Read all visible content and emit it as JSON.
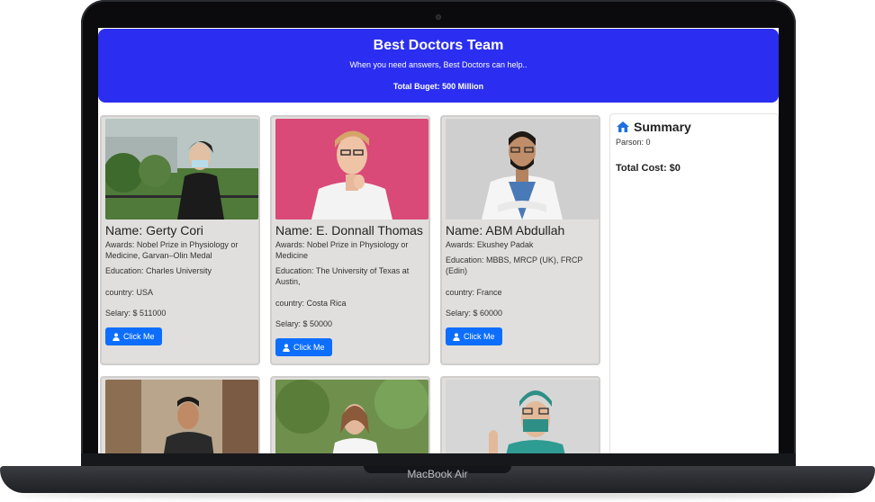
{
  "header": {
    "title": "Best Doctors Team",
    "subtitle": "When you need answers, Best Doctors can help..",
    "budget": "Total Buget: 500 Million"
  },
  "cards": [
    {
      "name": "Name: Gerty Cori",
      "awards": "Awards: Nobel Prize in Physiology or Medicine, Garvan–Olin Medal",
      "education": "Education: Charles University",
      "country": "country: USA",
      "salary": "Selary: $ 511000",
      "button": "Click Me"
    },
    {
      "name": "Name: E. Donnall Thomas",
      "awards": "Awards: Nobel Prize in Physiology or Medicine",
      "education": "Education: The University of Texas at Austin,",
      "country": "country: Costa Rica",
      "salary": "Selary: $ 50000",
      "button": "Click Me"
    },
    {
      "name": "Name: ABM Abdullah",
      "awards": "Awards: Ekushey Padak",
      "education": "Education: MBBS, MRCP (UK), FRCP (Edin)",
      "country": "country: France",
      "salary": "Selary: $ 60000",
      "button": "Click Me"
    }
  ],
  "summary": {
    "title": "Summary",
    "persons": "Parson: 0",
    "total_cost": "Total Cost: $0"
  },
  "device": {
    "model": "MacBook Air"
  },
  "colors": {
    "header_bg": "#2b2ef0",
    "button_bg": "#0d6efd",
    "card_bg": "#e0dfdd"
  },
  "icons": {
    "button": "user-icon",
    "summary": "home-icon"
  }
}
